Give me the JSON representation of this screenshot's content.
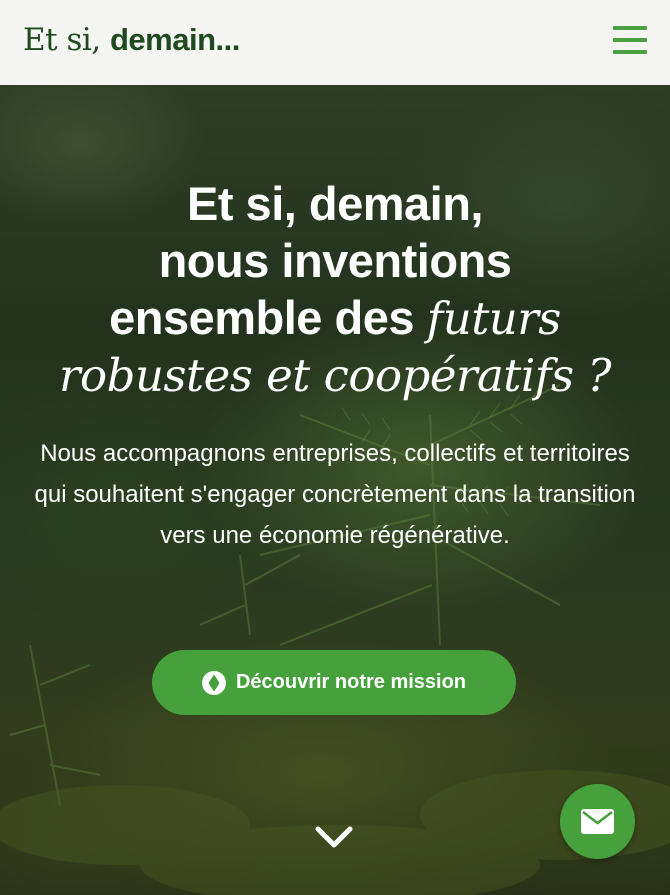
{
  "header": {
    "logo_part1": "Et si, ",
    "logo_part2": "demain...",
    "menu_icon": "hamburger-menu-icon"
  },
  "hero": {
    "headline_line1": "Et si, demain,",
    "headline_line2": "nous inventions",
    "headline_line3_bold": "ensemble des ",
    "headline_line3_italic": "futurs",
    "headline_line4_italic": "robustes et coopératifs ?",
    "subtext": "Nous accompagnons entreprises, collectifs et territoires qui souhaitent s'engager concrètement dans la transition vers une économie régénérative.",
    "cta_label": "Découvrir notre mission",
    "cta_icon": "compass-icon",
    "scroll_icon": "chevron-down-icon"
  },
  "contact_fab": {
    "icon": "envelope-icon"
  },
  "colors": {
    "brand_green": "#46a13c",
    "logo_dark_green": "#1f4a1e",
    "header_bg": "#f5f5f4"
  }
}
